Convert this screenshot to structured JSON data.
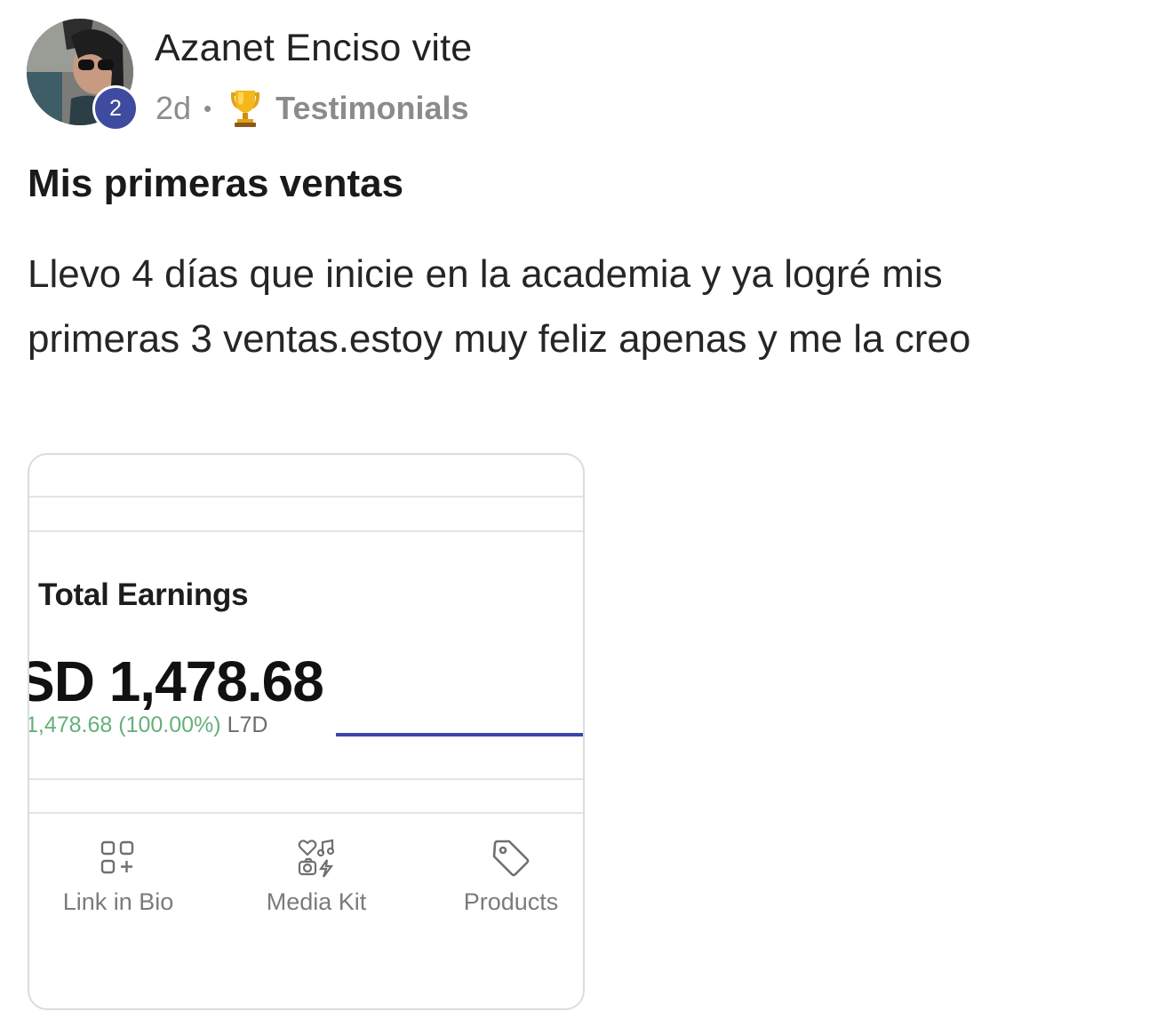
{
  "post": {
    "author": {
      "name": "Azanet Enciso vite",
      "level": "2"
    },
    "time": "2d",
    "separator": "•",
    "category": "Testimonials",
    "category_icon": "trophy-icon",
    "title": "Mis primeras ventas",
    "body": "Llevo 4 días que inicie en la academia y ya logré mis primeras 3 ventas.estoy muy feliz apenas y me la creo"
  },
  "attachment": {
    "earnings_label": "Total Earnings",
    "earnings_value": "SD 1,478.68",
    "earnings_change": "1,478.68 (100.00%)",
    "earnings_period": "L7D",
    "trend_color": "#3a45a8",
    "change_color": "#65b07a",
    "nav": [
      {
        "label": "Link in Bio",
        "icon": "grid-plus-icon"
      },
      {
        "label": "Media Kit",
        "icon": "media-kit-icon"
      },
      {
        "label": "Products",
        "icon": "tag-icon"
      }
    ]
  },
  "colors": {
    "level_badge": "#3e4b9e",
    "meta_text": "#8d8d8d"
  }
}
